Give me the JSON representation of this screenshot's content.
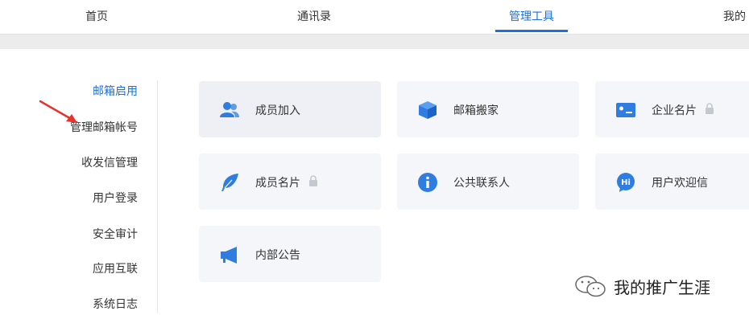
{
  "nav": {
    "tabs": [
      {
        "label": "首页"
      },
      {
        "label": "通讯录"
      },
      {
        "label": "管理工具"
      },
      {
        "label": "我的"
      }
    ],
    "active_index": 2
  },
  "sidebar": {
    "items": [
      {
        "label": "邮箱启用"
      },
      {
        "label": "管理邮箱帐号"
      },
      {
        "label": "收发信管理"
      },
      {
        "label": "用户登录"
      },
      {
        "label": "安全审计"
      },
      {
        "label": "应用互联"
      },
      {
        "label": "系统日志"
      }
    ],
    "active_index": 0
  },
  "cards": [
    {
      "label": "成员加入",
      "icon": "members-icon",
      "locked": false
    },
    {
      "label": "邮箱搬家",
      "icon": "box-icon",
      "locked": false
    },
    {
      "label": "企业名片",
      "icon": "business-card-icon",
      "locked": true
    },
    {
      "label": "成员名片",
      "icon": "feather-icon",
      "locked": true
    },
    {
      "label": "公共联系人",
      "icon": "info-icon",
      "locked": false
    },
    {
      "label": "用户欢迎信",
      "icon": "hi-bubble-icon",
      "locked": false
    },
    {
      "label": "内部公告",
      "icon": "megaphone-icon",
      "locked": false
    }
  ],
  "watermark": {
    "text": "我的推广生涯"
  },
  "colors": {
    "accent": "#1d6fdb",
    "icon_blue": "#2f7de1",
    "card_bg": "#f4f6f9",
    "arrow": "#e8322b"
  }
}
